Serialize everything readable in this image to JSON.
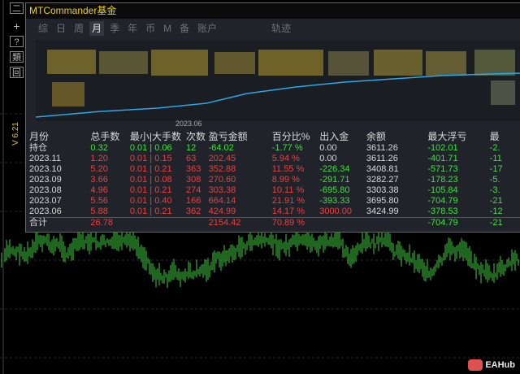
{
  "window": {
    "title": "MTCommander基金"
  },
  "toolbar": {
    "buttons": [
      "二",
      "+",
      "?",
      "類",
      "回"
    ],
    "version": "V 6.21"
  },
  "tabs": [
    "综",
    "日",
    "周",
    "月",
    "季",
    "年",
    "币",
    "M",
    "备",
    "账户"
  ],
  "active_tab": "月",
  "tab_extra": "轨迹",
  "mini_chart": {
    "date_label": "2023.06",
    "line_color": "#2aa8e8"
  },
  "table": {
    "headers": [
      "月份",
      "总手数",
      "最小|大手数",
      "次数",
      "盈亏金额",
      "百分比%",
      "出入金",
      "余额",
      "最大浮亏",
      "最"
    ],
    "rows": [
      {
        "cells": [
          "持仓",
          "0.32",
          "0.01 | 0.06",
          "12",
          "-64.02",
          "-1.77 %",
          "0.00",
          "3611.26",
          "-102.01",
          "-2."
        ],
        "kind": "open"
      },
      {
        "cells": [
          "2023.11",
          "1.20",
          "0.01 | 0.15",
          "63",
          "202.45",
          "5.94 %",
          "0.00",
          "3611.26",
          "-401.71",
          "-11"
        ],
        "kind": "month"
      },
      {
        "cells": [
          "2023.10",
          "5.20",
          "0.01 | 0.21",
          "363",
          "352.88",
          "11.55 %",
          "-226.34",
          "3408.81",
          "-571.73",
          "-17"
        ],
        "kind": "month"
      },
      {
        "cells": [
          "2023.09",
          "3.66",
          "0.01 | 0.08",
          "308",
          "270.60",
          "8.99 %",
          "-291.71",
          "3282.27",
          "-178.23",
          "-5."
        ],
        "kind": "month"
      },
      {
        "cells": [
          "2023.08",
          "4.96",
          "0.01 | 0.21",
          "274",
          "303.38",
          "10.11 %",
          "-695.80",
          "3303.38",
          "-105.84",
          "-3."
        ],
        "kind": "month"
      },
      {
        "cells": [
          "2023.07",
          "5.56",
          "0.01 | 0.40",
          "166",
          "664.14",
          "21.91 %",
          "-393.33",
          "3695.80",
          "-704.79",
          "-21"
        ],
        "kind": "month"
      },
      {
        "cells": [
          "2023.06",
          "5.88",
          "0.01 | 0.21",
          "362",
          "424.99",
          "14.17 %",
          "3000.00",
          "3424.99",
          "-378.53",
          "-12"
        ],
        "kind": "month"
      }
    ],
    "total": {
      "cells": [
        "合计",
        "26.78",
        "",
        "",
        "2154.42",
        "70.89 %",
        "",
        "",
        "-704.79",
        "-21"
      ]
    }
  },
  "watermark": {
    "text": "EAHub"
  },
  "colors": {
    "positive": "#3ee040",
    "negative": "#e84040",
    "title": "#f0d400",
    "candles": "#3ecc3e"
  }
}
